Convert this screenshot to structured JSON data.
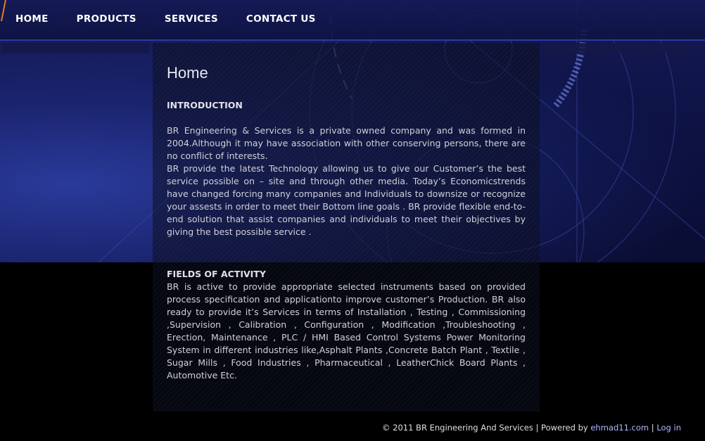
{
  "nav": {
    "items": [
      "HOME",
      "PRODUCTS",
      "SERVICES",
      "CONTACT US"
    ]
  },
  "main": {
    "title": "Home",
    "intro_heading": "INTRODUCTION",
    "intro_p1": "BR Engineering & Services is a private owned company and was formed in 2004.Although it may have association with other conserving persons, there are no conflict of interests.",
    "intro_p2": "BR provide the latest Technology allowing us to give our Customer’s the best service possible on – site and through other media. Today’s Economicstrends have changed forcing many companies and Individuals to downsize or recognize your assests in order to meet their Bottom line goals . BR provide flexible end-to-end solution that assist companies and individuals to meet their objectives by giving the best possible service .",
    "fields_heading": "FIELDS OF ACTIVITY",
    "fields_p": "BR is active to provide appropriate selected instruments based on provided process specification and applicationto improve customer’s Production. BR also ready to provide it’s Services in terms of Installation , Testing , Commissioning ,Supervision , Calibration , Configuration , Modification ,Troubleshooting , Erection, Maintenance , PLC / HMI Based Control Systems Power Monitoring System in different industries like,Asphalt Plants ,Concrete Batch Plant , Textile , Sugar Mills , Food Industries , Pharmaceutical , LeatherChick Board Plants , Automotive Etc."
  },
  "footer": {
    "copyright": "© 2011 BR Engineering And Services | Powered by ",
    "powered_link": "ehmad11.com",
    "separator": " | ",
    "login": "Log in"
  },
  "colors": {
    "accent": "#e87a1e",
    "nav_bar": "#141a55",
    "link": "#b0b8ff"
  }
}
